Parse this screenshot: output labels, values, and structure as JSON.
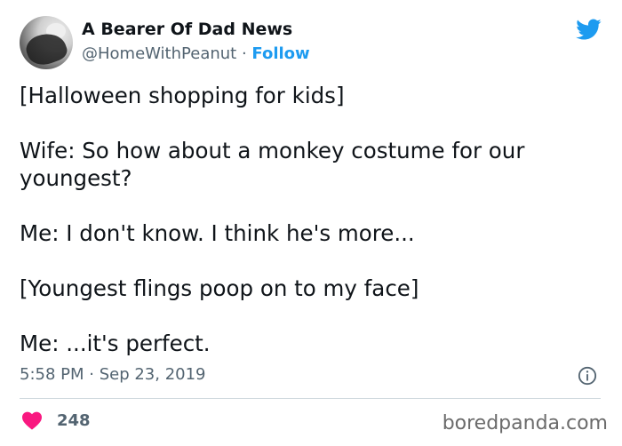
{
  "author": {
    "name": "A Bearer Of Dad News",
    "handle": "@HomeWithPeanut",
    "separator": " · ",
    "follow_label": "Follow"
  },
  "tweet": {
    "lines": [
      "[Halloween shopping for kids]",
      "Wife: So how about a monkey costume for our youngest?",
      "Me: I don't know. I think he's more...",
      "[Youngest flings poop on to my face]",
      "Me: ...it's perfect."
    ],
    "timestamp": "5:58 PM · Sep 23, 2019"
  },
  "engagement": {
    "likes": "248"
  },
  "watermark": "boredpanda.com",
  "icons": {
    "platform": "twitter-bird-icon",
    "info": "info-icon",
    "like": "heart-icon"
  },
  "colors": {
    "accent": "#1d9bf0",
    "heart": "#f91880",
    "muted": "#536471",
    "text": "#0f1419"
  }
}
